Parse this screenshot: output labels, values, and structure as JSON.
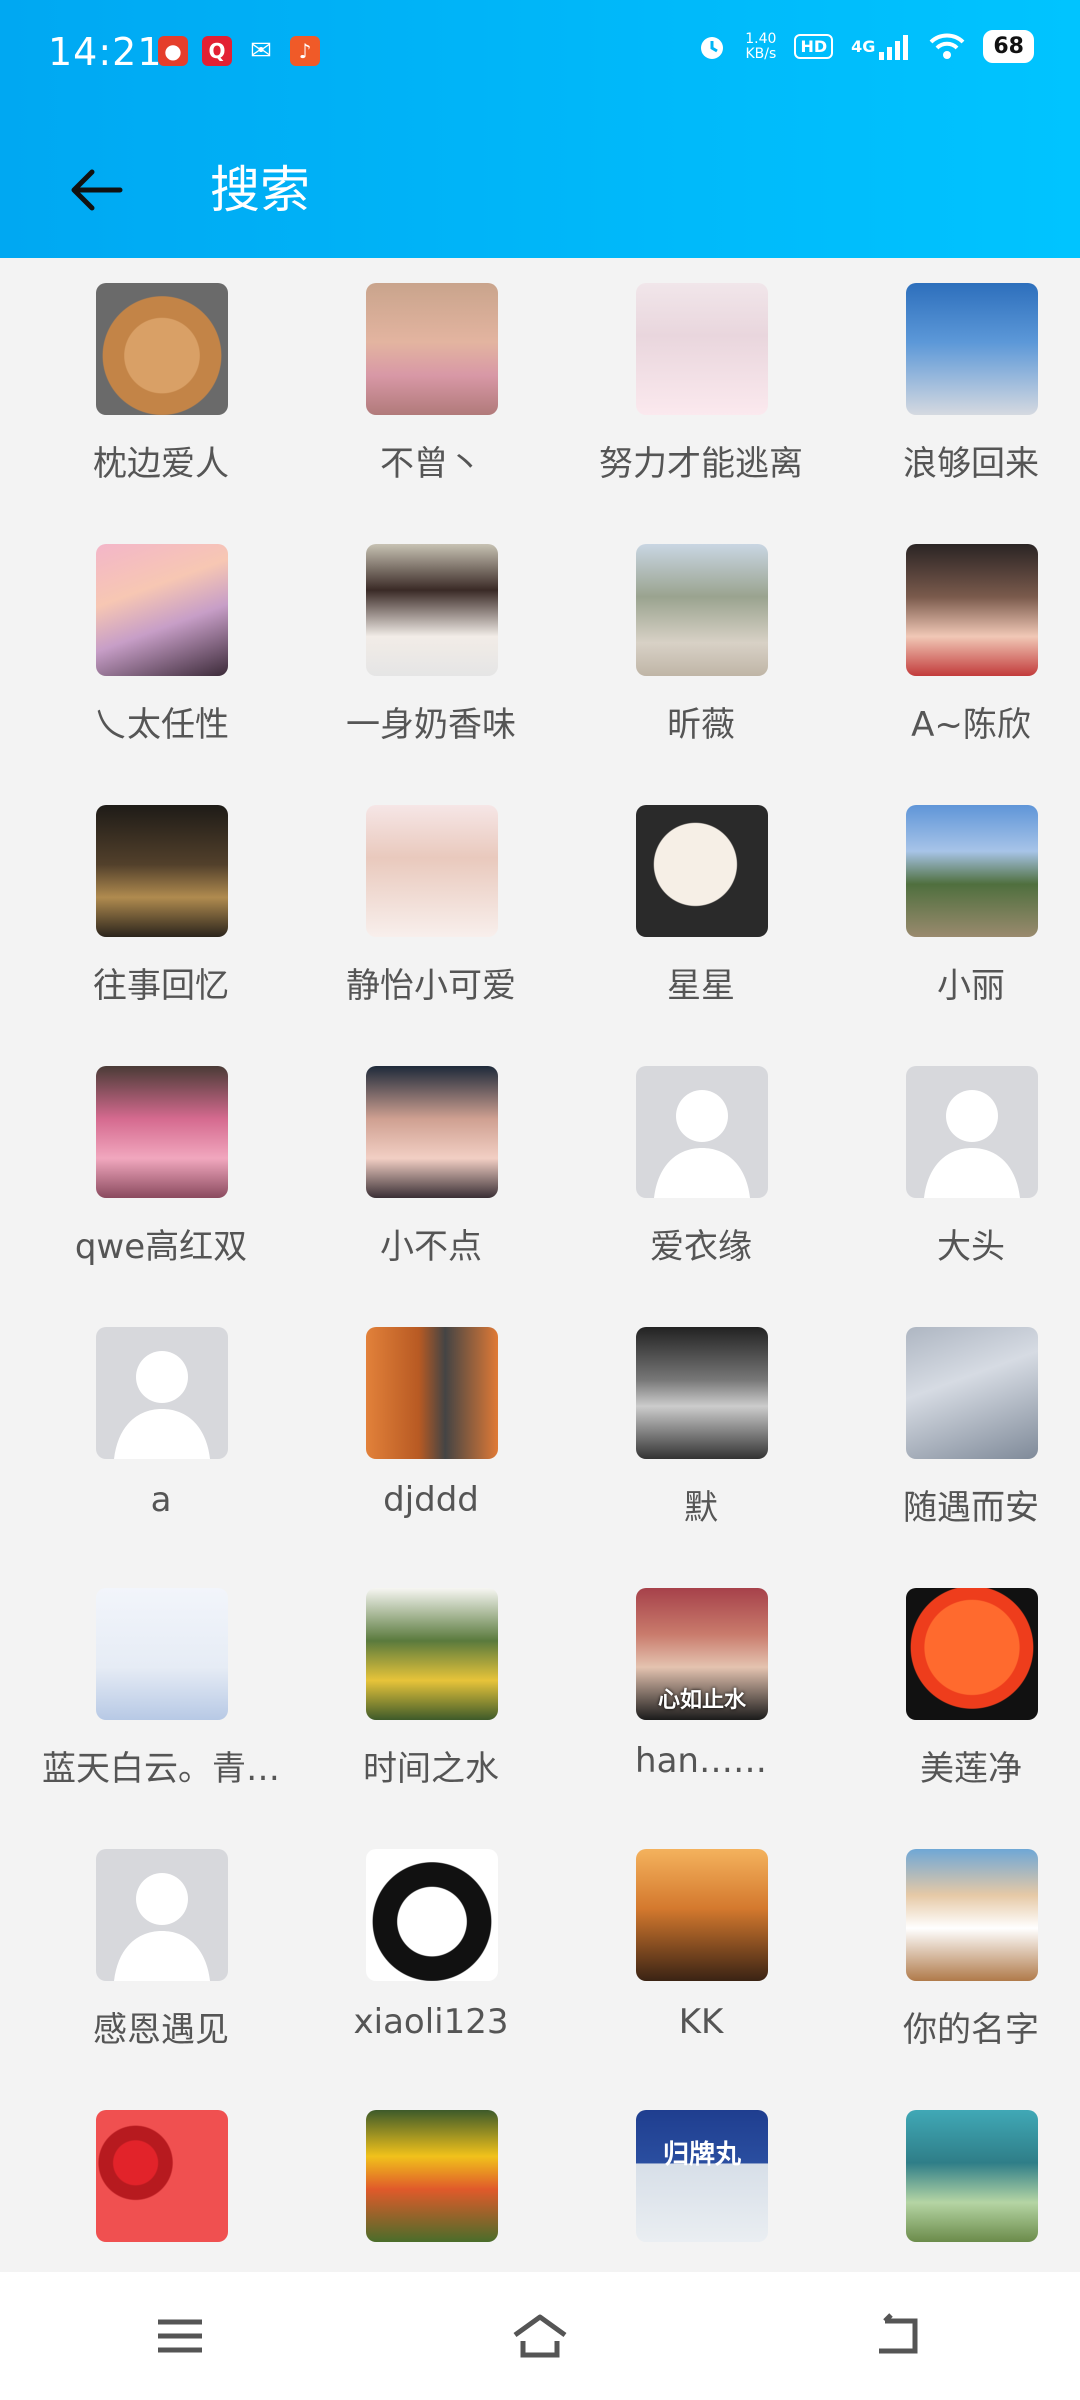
{
  "status_bar": {
    "time": "14:21",
    "net_speed_value": "1.40",
    "net_speed_unit": "KB/s",
    "hd": "HD",
    "network": "4G",
    "battery": "68",
    "notification_icons": [
      "baidu-icon",
      "qq-browser-icon",
      "wechat-icon",
      "listen-app-icon"
    ]
  },
  "header": {
    "title": "搜索"
  },
  "contacts": [
    {
      "name": "枕边爱人",
      "avatar": "poodle"
    },
    {
      "name": "不曾丶",
      "avatar": "girl-sunset"
    },
    {
      "name": "努力才能逃离",
      "avatar": "girl-pink"
    },
    {
      "name": "浪够回来",
      "avatar": "sky-toy"
    },
    {
      "name": "乀太任性",
      "avatar": "rainbow-palms"
    },
    {
      "name": "一身奶香味",
      "avatar": "girl-portrait"
    },
    {
      "name": "昕薇",
      "avatar": "road-trees"
    },
    {
      "name": "A~陈欣",
      "avatar": "mother-child"
    },
    {
      "name": "往事回忆",
      "avatar": "night-street"
    },
    {
      "name": "静怡小可爱",
      "avatar": "bride-couple"
    },
    {
      "name": "星星",
      "avatar": "puppy"
    },
    {
      "name": "小丽",
      "avatar": "landscape"
    },
    {
      "name": "qwe高红双",
      "avatar": "pink-hair"
    },
    {
      "name": "小不点",
      "avatar": "girl-face"
    },
    {
      "name": "爱衣缘",
      "avatar": "default"
    },
    {
      "name": "大头",
      "avatar": "default"
    },
    {
      "name": "a",
      "avatar": "default"
    },
    {
      "name": "djddd",
      "avatar": "door"
    },
    {
      "name": "默",
      "avatar": "bw-car"
    },
    {
      "name": "随遇而安",
      "avatar": "clouds"
    },
    {
      "name": "蓝天白云。青…",
      "avatar": "deer-art"
    },
    {
      "name": "时间之水",
      "avatar": "sunflowers"
    },
    {
      "name": "han……",
      "avatar": "elder-lady",
      "badge": "心如止水"
    },
    {
      "name": "美莲净",
      "avatar": "mic-orange"
    },
    {
      "name": "感恩遇见",
      "avatar": "default"
    },
    {
      "name": "xiaoli123",
      "avatar": "kuromi"
    },
    {
      "name": "KK",
      "avatar": "sunset-hands"
    },
    {
      "name": "你的名字",
      "avatar": "corgi"
    },
    {
      "name": "",
      "avatar": "strawberries"
    },
    {
      "name": "",
      "avatar": "yellow-flowers"
    },
    {
      "name": "",
      "avatar": "sign-guipaiwan"
    },
    {
      "name": "",
      "avatar": "playground"
    }
  ],
  "partial_row_avatar_text": "归牌丸",
  "navbar": {
    "buttons": [
      "menu-icon",
      "home-icon",
      "back-icon"
    ]
  }
}
